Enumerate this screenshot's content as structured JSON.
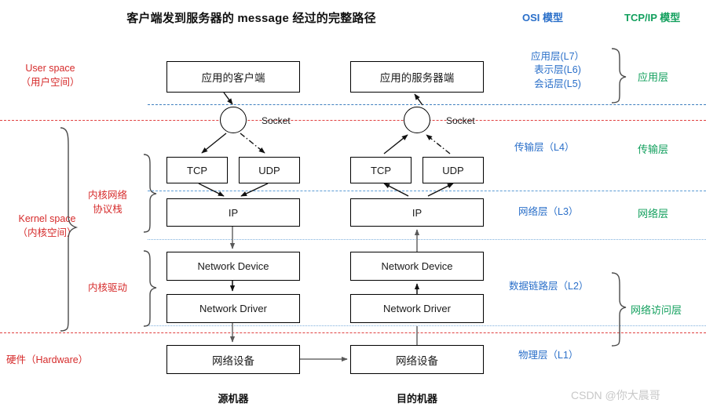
{
  "title": "客户端发到服务器的 message 经过的完整路径",
  "headers": {
    "osi": "OSI 模型",
    "tcpip": "TCP/IP 模型"
  },
  "left_annotations": {
    "user_space_en": "User space",
    "user_space_cn": "（用户空间）",
    "kernel_space_en": "Kernel space",
    "kernel_space_cn": "（内核空间）",
    "kernel_net_stack_l1": "内核网络",
    "kernel_net_stack_l2": "协议栈",
    "kernel_driver": "内核驱动",
    "hardware": "硬件（Hardware）"
  },
  "source_machine": {
    "caption": "源机器",
    "app": "应用的客户端",
    "socket": "Socket",
    "tcp": "TCP",
    "udp": "UDP",
    "ip": "IP",
    "network_device": "Network Device",
    "network_driver": "Network Driver",
    "hardware_device": "网络设备"
  },
  "dest_machine": {
    "caption": "目的机器",
    "app": "应用的服务器端",
    "socket": "Socket",
    "tcp": "TCP",
    "udp": "UDP",
    "ip": "IP",
    "network_device": "Network Device",
    "network_driver": "Network Driver",
    "hardware_device": "网络设备"
  },
  "osi_layers": {
    "l7": "应用层(L7）",
    "l6": "表示层(L6)",
    "l5": "会话层(L5)",
    "l4": "传输层（L4）",
    "l3": "网络层（L3）",
    "l2": "数据链路层（L2）",
    "l1": "物理层（L1）"
  },
  "tcpip_layers": {
    "application": "应用层",
    "transport": "传输层",
    "network": "网络层",
    "network_access": "网络访问层"
  },
  "colors": {
    "osi_blue": "#2a6fc9",
    "tcpip_green": "#13a05e",
    "annotation_red": "#d62b2b",
    "divider_blue": "#3f7fbf",
    "divider_red": "#e0403f",
    "watermark": "#c8c8c8"
  },
  "watermark": "CSDN @你大晨哥"
}
